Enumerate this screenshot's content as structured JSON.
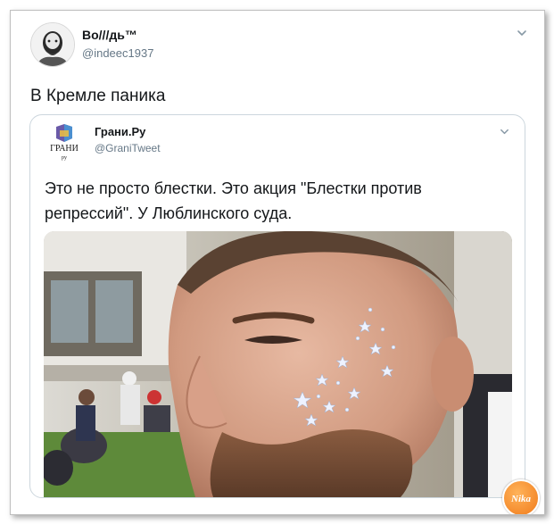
{
  "tweet": {
    "author_name": "Во///дь™",
    "author_handle": "@indeec1937",
    "text": "В Кремле паника",
    "avatar_icon": "bearded-man-portrait-icon",
    "menu_icon": "chevron-down-icon"
  },
  "quoted_tweet": {
    "author_name": "Грани.Ру",
    "author_handle": "@GraniTweet",
    "avatar_text": "ГРАНИ",
    "avatar_subtext": "ру",
    "text": "Это не просто блестки. Это акция \"Блестки против репрессий\". У Люблинского суда.",
    "menu_icon": "chevron-down-icon",
    "photo": "close-up photo of a bearded man with star-shaped glitter on his cheek, people sitting on the grass in the background"
  },
  "watermark": {
    "text": "Nika",
    "color": "#f07a1a"
  },
  "colors": {
    "text": "#14171a",
    "secondary": "#657786",
    "border": "#ccd6dd"
  }
}
